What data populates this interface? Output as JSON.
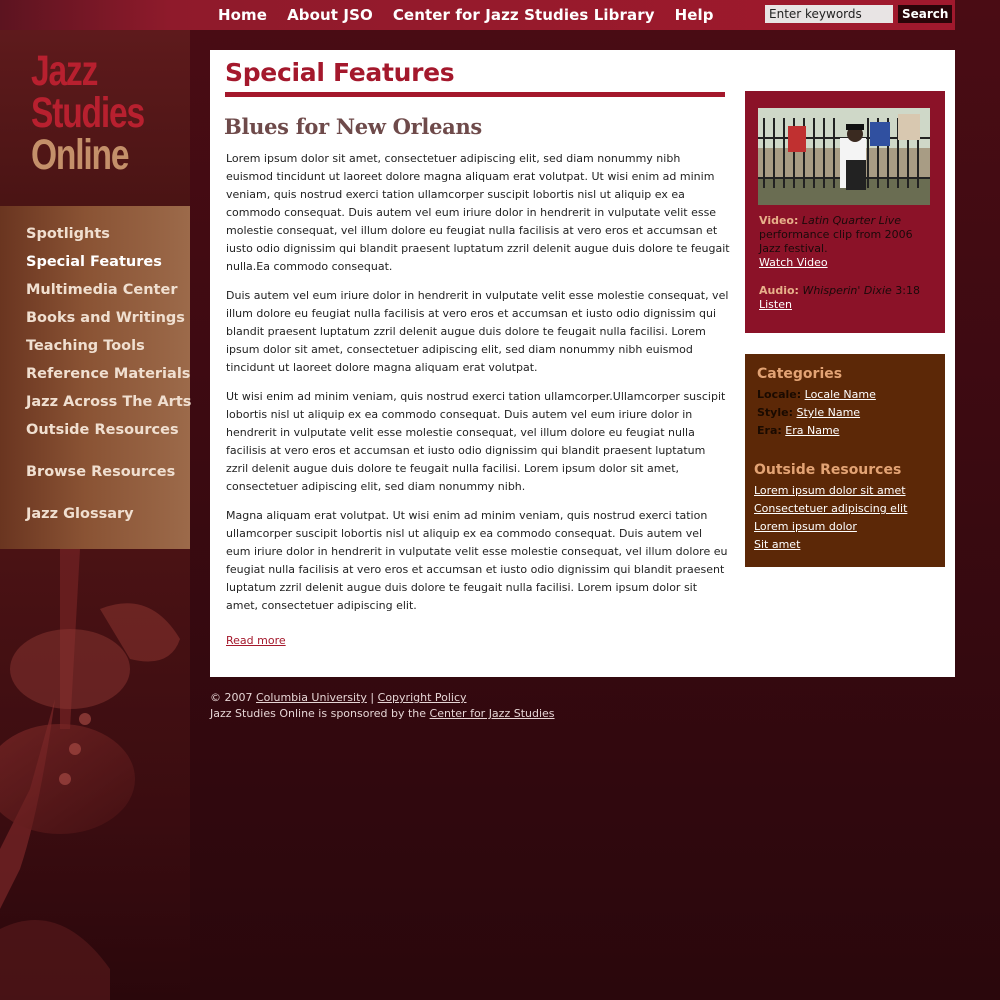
{
  "topnav": {
    "items": [
      "Home",
      "About JSO",
      "Center for Jazz Studies Library",
      "Help"
    ],
    "search_placeholder": "Enter keywords",
    "search_button": "Search"
  },
  "logo": {
    "line1": "Jazz",
    "line2": "Studies",
    "line3": "Online"
  },
  "sidebar": {
    "items": [
      "Spotlights",
      "Special Features",
      "Multimedia Center",
      "Books and Writings",
      "Teaching Tools",
      "Reference Materials",
      "Jazz Across The Arts",
      "Outside Resources",
      "Browse Resources",
      "Jazz Glossary"
    ]
  },
  "main": {
    "page_title": "Special Features",
    "article_title": "Blues for New Orleans",
    "paragraphs": [
      "Lorem ipsum dolor sit amet, consectetuer adipiscing elit, sed diam nonummy nibh euismod tincidunt ut laoreet dolore magna aliquam erat volutpat. Ut wisi enim ad minim veniam, quis nostrud exerci tation ullamcorper suscipit lobortis nisl ut aliquip ex ea commodo consequat. Duis autem vel eum iriure dolor in hendrerit in vulputate velit esse molestie consequat, vel illum dolore eu feugiat nulla facilisis at vero eros et accumsan et iusto odio dignissim qui blandit praesent luptatum zzril delenit augue duis dolore te feugait nulla.Ea commodo consequat.",
      "Duis autem vel eum iriure dolor in hendrerit in vulputate velit esse molestie consequat, vel illum dolore eu feugiat nulla facilisis at vero eros et accumsan et iusto odio dignissim qui blandit praesent luptatum zzril delenit augue duis dolore te feugait nulla facilisi. Lorem ipsum dolor sit amet, consectetuer adipiscing elit, sed diam nonummy nibh euismod tincidunt ut laoreet dolore magna aliquam erat volutpat.",
      "Ut wisi enim ad minim veniam, quis nostrud exerci tation ullamcorper.Ullamcorper suscipit lobortis nisl ut aliquip ex ea commodo consequat. Duis autem vel eum iriure dolor in hendrerit in vulputate velit esse molestie consequat, vel illum dolore eu feugiat nulla facilisis at vero eros et accumsan et iusto odio dignissim qui blandit praesent luptatum zzril delenit augue duis dolore te feugait nulla facilisi. Lorem ipsum dolor sit amet, consectetuer adipiscing elit, sed diam nonummy nibh.",
      "Magna aliquam erat volutpat. Ut wisi enim ad minim veniam, quis nostrud exerci tation ullamcorper suscipit lobortis nisl ut aliquip ex ea commodo consequat. Duis autem vel eum iriure dolor in hendrerit in vulputate velit esse molestie consequat, vel illum dolore eu feugiat nulla facilisis at vero eros et accumsan et iusto odio dignissim qui blandit praesent luptatum zzril delenit augue duis dolore te feugait nulla facilisi. Lorem ipsum dolor sit amet, consectetuer adipiscing elit."
    ],
    "read_more": "Read more"
  },
  "media": {
    "video_label": "Video:",
    "video_title": "Latin Quarter Live",
    "video_desc": " performance clip from 2006 Jazz festival.",
    "video_link": "Watch Video",
    "audio_label": "Audio:",
    "audio_title": "Whisperin' Dixie",
    "audio_duration": "3:18",
    "audio_link": "Listen"
  },
  "categories": {
    "heading": "Categories",
    "rows": [
      {
        "label": "Locale:",
        "value": "Locale Name"
      },
      {
        "label": "Style:",
        "value": "Style Name"
      },
      {
        "label": "Era:",
        "value": "Era Name"
      }
    ]
  },
  "outside": {
    "heading": "Outside Resources",
    "links": [
      "Lorem ipsum dolor sit amet",
      "Consectetuer adipiscing elit",
      "Lorem ipsum dolor",
      "Sit amet"
    ]
  },
  "footer": {
    "copyright": "© 2007",
    "university": "Columbia University",
    "separator": "|",
    "policy": "Copyright Policy",
    "sponsor_text": "Jazz Studies Online is sponsored by the",
    "sponsor_link": "Center for Jazz Studies"
  },
  "colors": {
    "accent_red": "#a4182c",
    "media_box": "#8b1228",
    "category_box": "#5c2807",
    "heading_orange": "#e3a374"
  },
  "icons": [
    "saxophone-illustration",
    "video-thumbnail"
  ]
}
